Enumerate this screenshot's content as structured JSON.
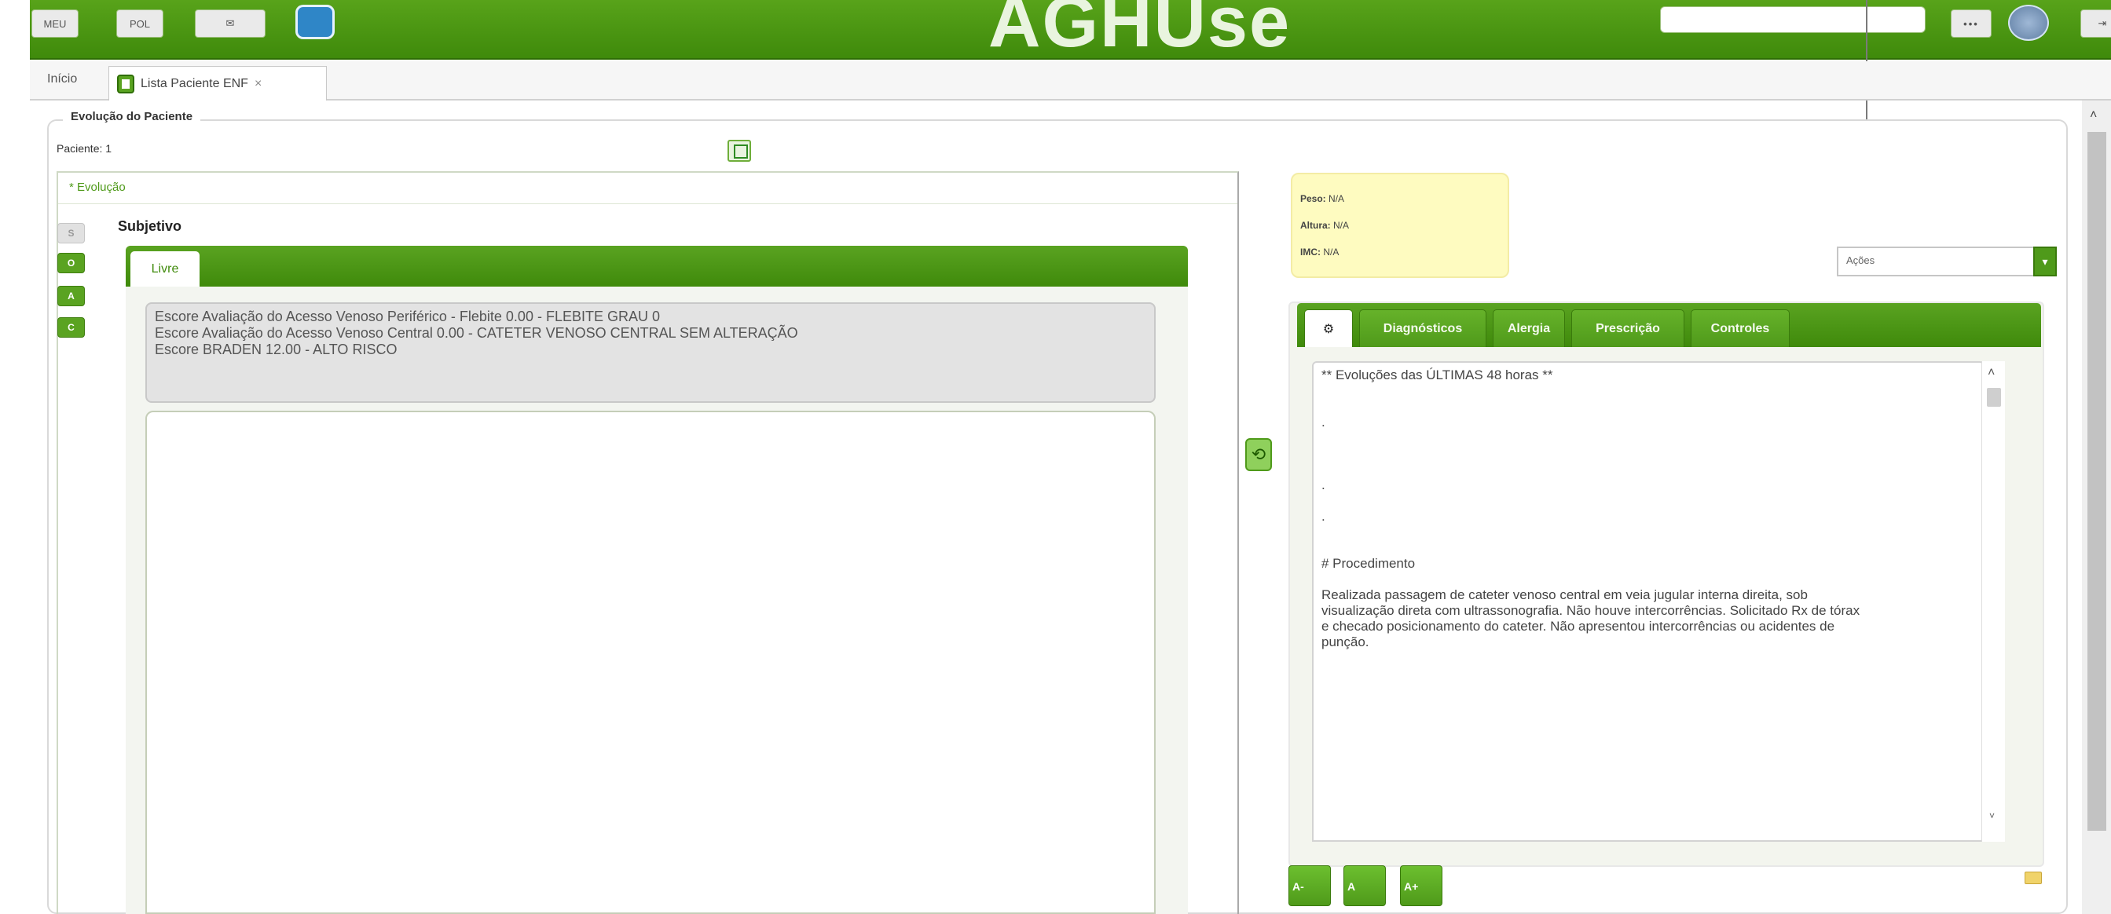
{
  "top_bar": {
    "app_title": "AGHUse",
    "btn_1": "MEU",
    "btn_2": "POL",
    "apps_label": "•••",
    "colors": {
      "primary_green": "#4f9a1a",
      "dark_green": "#3f8a0b"
    },
    "icons": [
      "home-icon",
      "calendar-icon",
      "mail-icon",
      "logo-icon",
      "apps-icon",
      "user-avatar-icon",
      "logout-icon"
    ]
  },
  "tabs": {
    "inicio": "Início",
    "active_tab": "Lista Paciente ENF",
    "close_symbol": "×"
  },
  "panel": {
    "legend": "Evolução do Paciente",
    "patient_label": "Paciente: 1",
    "evolution_header": "* Evolução"
  },
  "soap": {
    "buttons": [
      "S",
      "O",
      "A",
      "C"
    ],
    "active": "S",
    "section_title": "Subjetivo",
    "free_tab": "Livre",
    "scores": [
      "Escore Avaliação do Acesso Venoso Periférico - Flebite 0.00 - FLEBITE GRAU 0",
      "Escore Avaliação do Acesso Venoso Central 0.00 - CATETER VENOSO CENTRAL SEM ALTERAÇÃO",
      "Escore BRADEN 12.00 - ALTO RISCO"
    ],
    "free_text_value": ""
  },
  "vitals": {
    "peso_label": "Peso:",
    "peso_value": "N/A",
    "altura_label": "Altura:",
    "altura_value": "N/A",
    "imc_label": "IMC:",
    "imc_value": "N/A"
  },
  "actions": {
    "select_value": "Ações"
  },
  "history": {
    "tabs": [
      "Diagnósticos",
      "Alergia",
      "Prescrição",
      "Controles"
    ],
    "first_tab_icon": "gear-icon",
    "lines": [
      "** Evoluções das ÚLTIMAS 48 horas **",
      "",
      "",
      ".",
      "",
      "",
      "",
      ".",
      "",
      ".",
      "",
      "",
      "# Procedimento",
      "",
      "Realizada passagem de cateter venoso central em veia jugular interna direita, sob",
      "visualização direta com ultrassonografia. Não houve intercorrências. Solicitado Rx de tórax",
      "e checado posicionamento do cateter. Não apresentou intercorrências ou acidentes de",
      "punção."
    ]
  },
  "font_controls": [
    "A-",
    "A",
    "A+"
  ]
}
